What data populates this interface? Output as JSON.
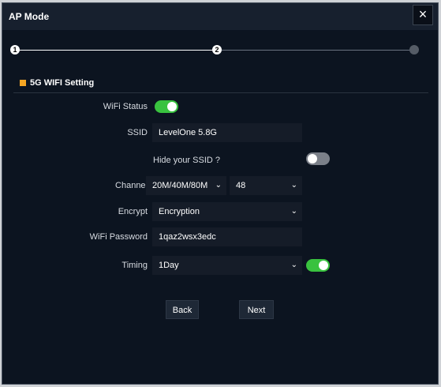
{
  "window": {
    "title": "AP Mode",
    "close_icon": "×"
  },
  "stepper": {
    "steps": [
      "1",
      "2",
      ""
    ],
    "current_step": 2
  },
  "section": {
    "title": "5G WIFI Setting",
    "accent": "#f5a623"
  },
  "form": {
    "wifi_status": {
      "label": "WiFi Status",
      "enabled": true
    },
    "ssid": {
      "label": "SSID",
      "value": "LevelOne 5.8G"
    },
    "hide_ssid": {
      "label": "Hide your SSID ?",
      "enabled": false
    },
    "channel": {
      "label": "Channel",
      "bandwidth": "20M/40M/80M",
      "number": "48"
    },
    "encrypt": {
      "label": "Encrypt",
      "value": "Encryption"
    },
    "password": {
      "label": "WiFi Password",
      "value": "1qaz2wsx3edc"
    },
    "timing": {
      "label": "Timing",
      "value": "1Day",
      "enabled": true
    }
  },
  "buttons": {
    "back": "Back",
    "next": "Next"
  },
  "colors": {
    "toggle_on": "#39c23f",
    "toggle_off": "#7b8089",
    "background": "#0c1420"
  }
}
